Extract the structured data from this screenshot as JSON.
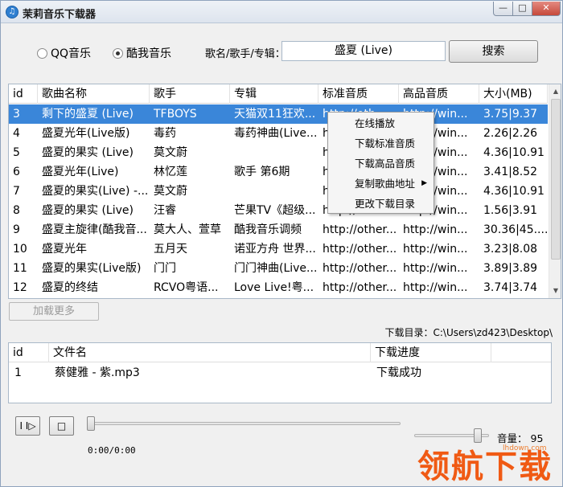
{
  "window": {
    "title": "茉莉音乐下载器",
    "app_icon": "note-icon",
    "controls": {
      "minimize": "—",
      "maximize": "□",
      "close": "✕"
    }
  },
  "source": {
    "options": [
      {
        "label": "QQ音乐",
        "selected": false
      },
      {
        "label": "酷我音乐",
        "selected": true
      }
    ]
  },
  "search": {
    "label": "歌名/歌手/专辑：",
    "value": "盛夏 (Live)",
    "button": "搜索"
  },
  "results": {
    "columns": [
      "id",
      "歌曲名称",
      "歌手",
      "专辑",
      "标准音质",
      "高品音质",
      "大小(MB)"
    ],
    "selected_index": 0,
    "rows": [
      [
        "3",
        "剩下的盛夏 (Live)",
        "TFBOYS",
        "天猫双11狂欢...",
        "http://oth...",
        "http://win...",
        "3.75|9.37"
      ],
      [
        "4",
        "盛夏光年(Live版)",
        "毒药",
        "毒药神曲(Live...",
        "http://oth...",
        "http://win...",
        "2.26|2.26"
      ],
      [
        "5",
        "盛夏的果实 (Live)",
        "莫文蔚",
        "",
        "http://oth...",
        "http://win...",
        "4.36|10.91"
      ],
      [
        "6",
        "盛夏光年(Live)",
        "林忆莲",
        "歌手 第6期",
        "http://oth...",
        "http://win...",
        "3.41|8.52"
      ],
      [
        "7",
        "盛夏的果实(Live) -...",
        "莫文蔚",
        "",
        "http://oth...",
        "http://win...",
        "4.36|10.91"
      ],
      [
        "8",
        "盛夏的果实 (Live)",
        "汪睿",
        "芒果TV《超级...",
        "http://oth...",
        "http://win...",
        "1.56|3.91"
      ],
      [
        "9",
        "盛夏主旋律(酷我音...",
        "莫大人、萱草",
        "酷我音乐调频",
        "http://other...",
        "http://win...",
        "30.36|45...."
      ],
      [
        "10",
        "盛夏光年",
        "五月天",
        "诺亚方舟 世界...",
        "http://other...",
        "http://win...",
        "3.23|8.08"
      ],
      [
        "11",
        "盛夏的果实(Live版)",
        "门门",
        "门门神曲(Live...",
        "http://other...",
        "http://win...",
        "3.89|3.89"
      ],
      [
        "12",
        "盛夏的终结",
        "RCVO粤语...",
        "Love Live!粤...",
        "http://other...",
        "http://win...",
        "3.74|3.74"
      ]
    ]
  },
  "context_menu": {
    "items": [
      {
        "label": "在线播放",
        "submenu": false
      },
      {
        "label": "下载标准音质",
        "submenu": false
      },
      {
        "label": "下载高品音质",
        "submenu": false
      },
      {
        "label": "复制歌曲地址",
        "submenu": true
      },
      {
        "label": "更改下载目录",
        "submenu": false
      }
    ]
  },
  "load_more": "加载更多",
  "download_dir": "下载目录：C:\\Users\\zd423\\Desktop\\",
  "downloads": {
    "columns": [
      "id",
      "文件名",
      "下载进度"
    ],
    "rows": [
      [
        "1",
        "蔡健雅 - 紫.mp3",
        "下载成功"
      ]
    ]
  },
  "player": {
    "play_label": "I I▷",
    "stop_label": "□",
    "time": "0:00/0:00",
    "seek_fraction": 0,
    "volume_label": "音量：",
    "volume": "95",
    "volume_fraction": 0.95
  },
  "watermark": {
    "url": "lhdown.com",
    "text": "领航下载"
  }
}
